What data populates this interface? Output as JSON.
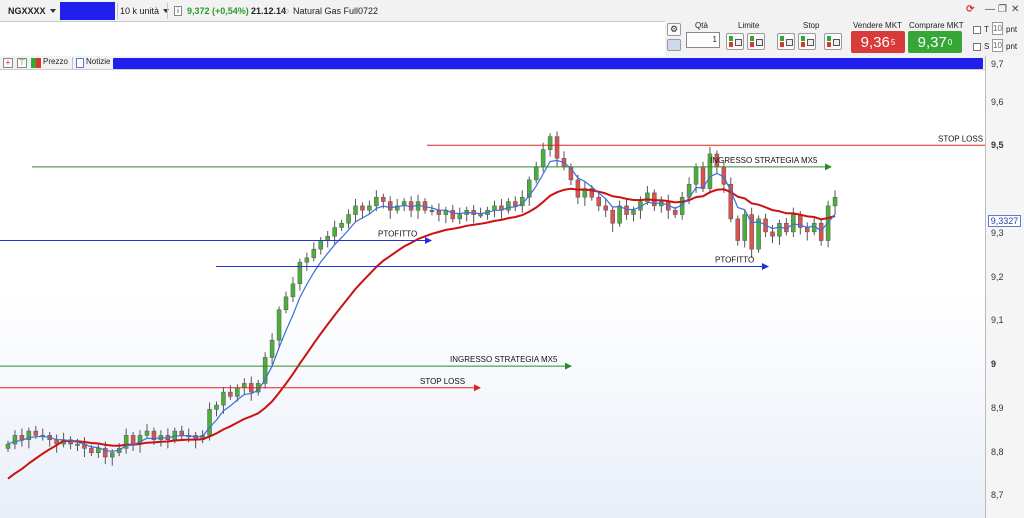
{
  "toolbar": {
    "symbol": "NGXXXX",
    "quantity_unit": "10 k unità",
    "price_change": "9,372 (+0,54%)",
    "time": "21.12.14",
    "instrument_name": "Natural Gas Full0722"
  },
  "order_panel": {
    "qty_label": "Qtà",
    "qty_value": "1",
    "limit_label": "Limite",
    "stop_label": "Stop",
    "sell_label": "Vendere MKT",
    "buy_label": "Comprare MKT",
    "sell_price": "9,36",
    "sell_price_sup": "5",
    "buy_price": "9,37",
    "buy_price_sup": "0",
    "t_label": "T",
    "s_label": "S",
    "t_value": "10",
    "s_value": "10",
    "t_unit": "pnt",
    "s_unit": "pnt"
  },
  "tabs": {
    "price_label": "Prezzo",
    "news_label": "Notizie"
  },
  "colors": {
    "sell": "#d93a3a",
    "buy": "#36a636",
    "up_candle": "#4caf3d",
    "down_candle": "#d9534f",
    "ma_fast": "#3a6fd8",
    "ma_slow": "#cc1111",
    "stop_line": "#dd2222",
    "entry_line": "#2a8a2a",
    "target_line": "#2233dd"
  },
  "price_axis": {
    "ticks": [
      "9,7",
      "9,6",
      "9,5",
      "9,3",
      "9,2",
      "9,1",
      "9",
      "8,9",
      "8,8",
      "8,7"
    ],
    "bold_ticks": [
      "9,5",
      "9"
    ],
    "current_price": "9,3327"
  },
  "chart_data": {
    "type": "candlestick",
    "ylim": [
      8.66,
      9.72
    ],
    "closes": [
      8.82,
      8.84,
      8.83,
      8.85,
      8.84,
      8.84,
      8.83,
      8.82,
      8.83,
      8.82,
      8.82,
      8.81,
      8.8,
      8.81,
      8.79,
      8.8,
      8.81,
      8.84,
      8.82,
      8.84,
      8.85,
      8.83,
      8.84,
      8.83,
      8.85,
      8.84,
      8.84,
      8.83,
      8.84,
      8.9,
      8.91,
      8.94,
      8.93,
      8.95,
      8.96,
      8.94,
      8.96,
      9.02,
      9.06,
      9.13,
      9.16,
      9.19,
      9.24,
      9.25,
      9.27,
      9.29,
      9.3,
      9.32,
      9.33,
      9.35,
      9.37,
      9.36,
      9.37,
      9.39,
      9.38,
      9.36,
      9.37,
      9.38,
      9.36,
      9.38,
      9.36,
      9.36,
      9.35,
      9.36,
      9.34,
      9.35,
      9.36,
      9.35,
      9.35,
      9.36,
      9.37,
      9.36,
      9.38,
      9.37,
      9.39,
      9.43,
      9.46,
      9.5,
      9.53,
      9.48,
      9.46,
      9.43,
      9.39,
      9.41,
      9.39,
      9.37,
      9.36,
      9.33,
      9.37,
      9.35,
      9.36,
      9.38,
      9.4,
      9.37,
      9.38,
      9.36,
      9.35,
      9.39,
      9.42,
      9.46,
      9.41,
      9.49,
      9.46,
      9.42,
      9.34,
      9.29,
      9.35,
      9.27,
      9.34,
      9.31,
      9.3,
      9.33,
      9.31,
      9.35,
      9.32,
      9.31,
      9.33,
      9.29,
      9.37,
      9.39
    ],
    "moving_averages": [
      "fast",
      "slow"
    ],
    "annotations": [
      {
        "label": "STOP LOSS",
        "price": 9.51,
        "color": "stop"
      },
      {
        "label": "INGRESSO STRATEGIA MX5",
        "price": 9.46,
        "color": "entry"
      },
      {
        "label": "PTOFITTO",
        "price": 9.29,
        "color": "target"
      },
      {
        "label": "PTOFITTO",
        "price": 9.23,
        "color": "target"
      },
      {
        "label": "INGRESSO STRATEGIA MX5",
        "price": 9.0,
        "color": "entry"
      },
      {
        "label": "STOP LOSS",
        "price": 8.95,
        "color": "stop"
      }
    ]
  }
}
